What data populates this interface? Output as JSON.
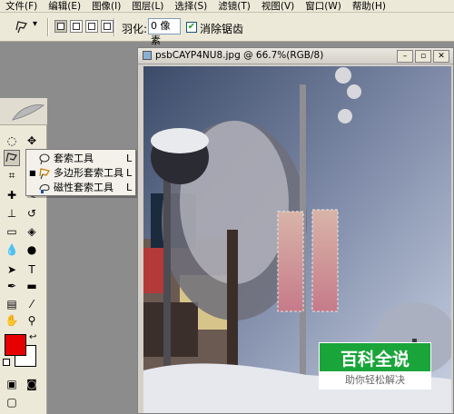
{
  "menubar": {
    "items": [
      "文件(F)",
      "编辑(E)",
      "图像(I)",
      "图层(L)",
      "选择(S)",
      "滤镜(T)",
      "视图(V)",
      "窗口(W)",
      "帮助(H)"
    ]
  },
  "options": {
    "feather_label": "羽化:",
    "feather_value": "0 像素",
    "antialias_label": "消除锯齿",
    "antialias_checked": true
  },
  "document": {
    "title": "psbCAYP4NU8.jpg @ 66.7%(RGB/8)",
    "buttons": [
      "minimize-icon",
      "restore-icon",
      "close-icon"
    ]
  },
  "flyout": {
    "items": [
      {
        "label": "套索工具",
        "key": "L",
        "icon": "lasso-icon",
        "selected": false
      },
      {
        "label": "多边形套索工具",
        "key": "L",
        "icon": "polygonal-lasso-icon",
        "selected": true
      },
      {
        "label": "磁性套索工具",
        "key": "L",
        "icon": "magnetic-lasso-icon",
        "selected": false
      }
    ]
  },
  "colors": {
    "foreground": "#e60000",
    "background": "#ffffff"
  },
  "watermark": {
    "title": "百科全说",
    "subtitle": "助你轻松解决"
  }
}
